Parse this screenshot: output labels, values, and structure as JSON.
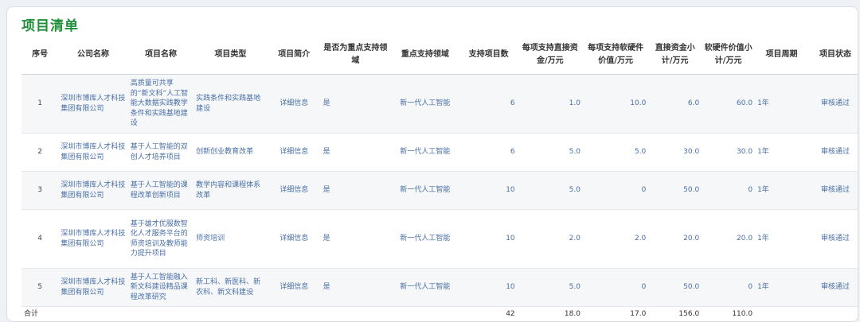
{
  "page": {
    "title": "项目清单"
  },
  "headers": [
    "序号",
    "公司名称",
    "项目名称",
    "项目类型",
    "项目简介",
    "是否为重点支持领域",
    "重点支持领域",
    "支持项目数",
    "每项支持直接资金/万元",
    "每项支持软硬件价值/万元",
    "直接资金小计/万元",
    "软硬件价值小计/万元",
    "项目周期",
    "项目状态"
  ],
  "rows": [
    {
      "seq": "1",
      "company": "深圳市博库人才科技集团有限公司",
      "name": "高质量可共享的“新文科”人工智能大数据实践教学条件和实践基地建设",
      "type": "实践条件和实践基地建设",
      "intro": "详细信息",
      "key": "是",
      "field": "新一代人工智能",
      "count": "6",
      "direct": "1.0",
      "soft": "10.0",
      "direct_sub": "6.0",
      "soft_sub": "60.0",
      "period": "1年",
      "status": "审核通过"
    },
    {
      "seq": "2",
      "company": "深圳市博库人才科技集团有限公司",
      "name": "基于人工智能的双创人才培养项目",
      "type": "创新创业教育改革",
      "intro": "详细信息",
      "key": "是",
      "field": "新一代人工智能",
      "count": "6",
      "direct": "5.0",
      "soft": "5.0",
      "direct_sub": "30.0",
      "soft_sub": "30.0",
      "period": "1年",
      "status": "审核通过"
    },
    {
      "seq": "3",
      "company": "深圳市博库人才科技集团有限公司",
      "name": "基于人工智能的课程改革创新项目",
      "type": "教学内容和课程体系改革",
      "intro": "详细信息",
      "key": "是",
      "field": "新一代人工智能",
      "count": "10",
      "direct": "5.0",
      "soft": "0",
      "direct_sub": "50.0",
      "soft_sub": "0",
      "period": "1年",
      "status": "审核通过"
    },
    {
      "seq": "4",
      "company": "深圳市博库人才科技集团有限公司",
      "name": "基于雄才优服数智化人才服务平台的师资培训及教师能力提升项目",
      "type": "师资培训",
      "intro": "详细信息",
      "key": "是",
      "field": "新一代人工智能",
      "count": "10",
      "direct": "2.0",
      "soft": "2.0",
      "direct_sub": "20.0",
      "soft_sub": "20.0",
      "period": "1年",
      "status": "审核通过"
    },
    {
      "seq": "5",
      "company": "深圳市博库人才科技集团有限公司",
      "name": "基于人工智能融入新文科建设精品课程改革研究",
      "type": "新工科、新医科、新农科、新文科建设",
      "intro": "详细信息",
      "key": "是",
      "field": "新一代人工智能",
      "count": "10",
      "direct": "5.0",
      "soft": "0",
      "direct_sub": "50.0",
      "soft_sub": "0",
      "period": "1年",
      "status": "审核通过"
    }
  ],
  "total": {
    "label": "合计",
    "count": "42",
    "direct": "18.0",
    "soft": "17.0",
    "direct_sub": "156.0",
    "soft_sub": "110.0"
  }
}
